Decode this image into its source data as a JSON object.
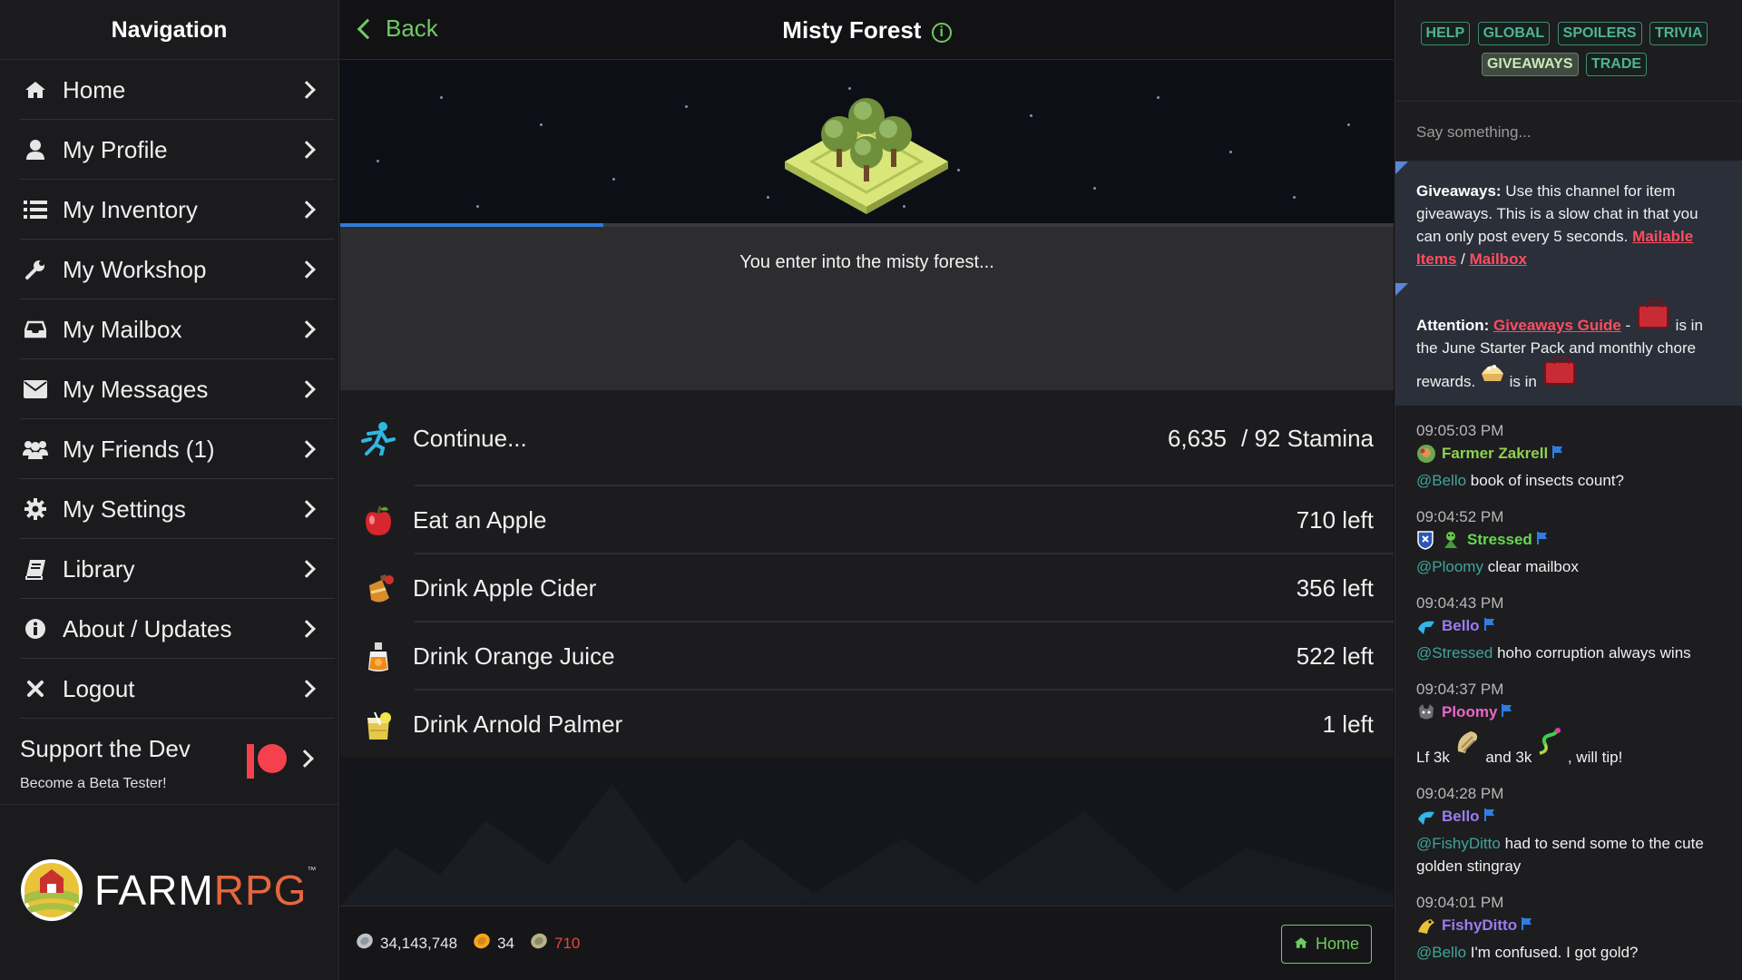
{
  "sidebar": {
    "title": "Navigation",
    "items": [
      {
        "label": "Home",
        "icon": "home-icon"
      },
      {
        "label": "My Profile",
        "icon": "user-icon"
      },
      {
        "label": "My Inventory",
        "icon": "list-icon"
      },
      {
        "label": "My Workshop",
        "icon": "wrench-icon"
      },
      {
        "label": "My Mailbox",
        "icon": "inbox-icon"
      },
      {
        "label": "My Messages",
        "icon": "envelope-icon"
      },
      {
        "label": "My Friends (1)",
        "icon": "users-icon"
      },
      {
        "label": "My Settings",
        "icon": "gear-icon"
      },
      {
        "label": "Library",
        "icon": "book-icon"
      },
      {
        "label": "About / Updates",
        "icon": "info-icon"
      },
      {
        "label": "Logout",
        "icon": "close-icon"
      }
    ],
    "support": {
      "title": "Support the Dev",
      "subtitle": "Become a Beta Tester!",
      "icon": "patreon-icon"
    },
    "brand": {
      "farm": "FARM",
      "rpg": "RPG",
      "tm": "™"
    }
  },
  "header": {
    "back_label": "Back",
    "title": "Misty Forest",
    "info_glyph": "i"
  },
  "explore": {
    "progress_fraction": 0.25,
    "message": "You enter into the misty forest..."
  },
  "actions": [
    {
      "label": "Continue...",
      "value": "6,635",
      "suffix": "/ 92 Stamina",
      "icon": "runner-icon"
    },
    {
      "label": "Eat an Apple",
      "value": "710 left",
      "icon": "apple-icon"
    },
    {
      "label": "Drink Apple Cider",
      "value": "356 left",
      "icon": "cider-icon"
    },
    {
      "label": "Drink Orange Juice",
      "value": "522 left",
      "icon": "orange-juice-icon"
    },
    {
      "label": "Drink Arnold Palmer",
      "value": "1 left",
      "icon": "arnold-palmer-icon"
    }
  ],
  "footer": {
    "silver": "34,143,748",
    "gold": "34",
    "apples": "710",
    "home_label": "Home"
  },
  "chat": {
    "tabs": [
      "HELP",
      "GLOBAL",
      "SPOILERS",
      "TRIVIA",
      "GIVEAWAYS",
      "TRADE"
    ],
    "active_tab": "GIVEAWAYS",
    "placeholder": "Say something...",
    "notice1": {
      "bold": "Giveaways:",
      "text": "Use this channel for item giveaways. This is a slow chat in that you can only post every 5 seconds.",
      "link1": "Mailable Items",
      "sep": "/",
      "link2": "Mailbox"
    },
    "notice2": {
      "bold": "Attention:",
      "link": "Giveaways Guide",
      "dash": "-",
      "t1": "is in the June Starter Pack and monthly chore rewards.",
      "t2": "is in"
    },
    "messages": [
      {
        "time": "09:05:03 PM",
        "user": "Farmer Zakrell",
        "color": "#8fd14f",
        "mention": "@Bello",
        "text": "book of insects count?"
      },
      {
        "time": "09:04:52 PM",
        "user": "Stressed",
        "color": "#67d84f",
        "mention": "@Ploomy",
        "text": "clear mailbox"
      },
      {
        "time": "09:04:43 PM",
        "user": "Bello",
        "color": "#9a7cf0",
        "mention": "@Stressed",
        "text": "hoho corruption always wins"
      },
      {
        "time": "09:04:37 PM",
        "user": "Ploomy",
        "color": "#e866c8",
        "pre": "Lf 3k",
        "mid": "and 3k",
        "post": ", will tip!"
      },
      {
        "time": "09:04:28 PM",
        "user": "Bello",
        "color": "#9a7cf0",
        "mention": "@FishyDitto",
        "text": "had to send some to the cute golden stingray"
      },
      {
        "time": "09:04:01 PM",
        "user": "FishyDitto",
        "color": "#9a7cf0",
        "mention": "@Bello",
        "text": "I'm confused. I got gold?"
      }
    ]
  },
  "colors": {
    "accent_green": "#6fca62",
    "link_red": "#ff4d5e",
    "mention_teal": "#3fa49a",
    "progress_blue": "#2d7bdc"
  }
}
